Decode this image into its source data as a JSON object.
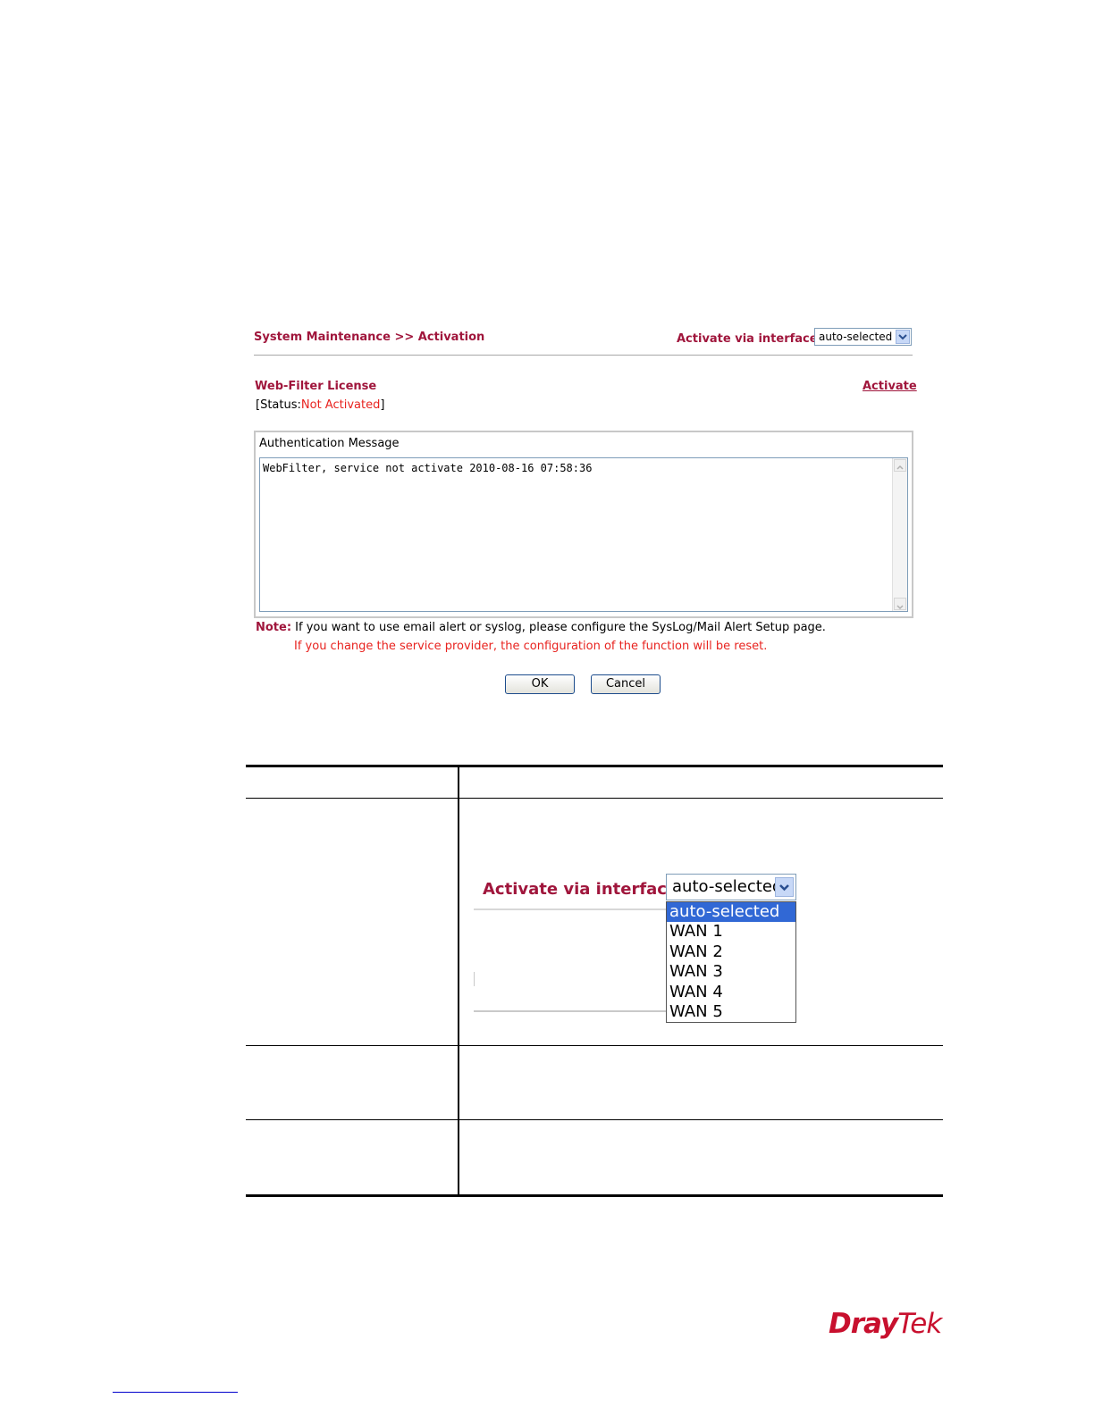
{
  "screenshot": {
    "breadcrumb": "System Maintenance >> Activation",
    "activate_via_label": "Activate via interface :",
    "interface_selected": "auto-selected",
    "license_title": "Web-Filter License",
    "activate_link": "Activate",
    "status_prefix": "[Status:",
    "status_value": "Not Activated",
    "status_suffix": "]",
    "auth_label": "Authentication Message",
    "auth_message": "WebFilter, service not activate 2010-08-16 07:58:36",
    "note_label": "Note:",
    "note_line1": " If you want to use email alert or syslog, please configure the  SysLog/Mail Alert Setup  page.",
    "note_line2": "If you change the service provider, the configuration of the function will be reset.",
    "ok_label": "OK",
    "cancel_label": "Cancel"
  },
  "zoom_dropdown": {
    "label": "Activate via interface :",
    "selected": "auto-selected",
    "options": [
      "auto-selected",
      "WAN 1",
      "WAN 2",
      "WAN 3",
      "WAN 4",
      "WAN 5"
    ]
  },
  "footer": {
    "logo_dray": "Dray",
    "logo_tek": "Tek"
  },
  "colors": {
    "brand": "#a0163c",
    "alert_red": "#e8231f",
    "highlight": "#3168d5"
  }
}
